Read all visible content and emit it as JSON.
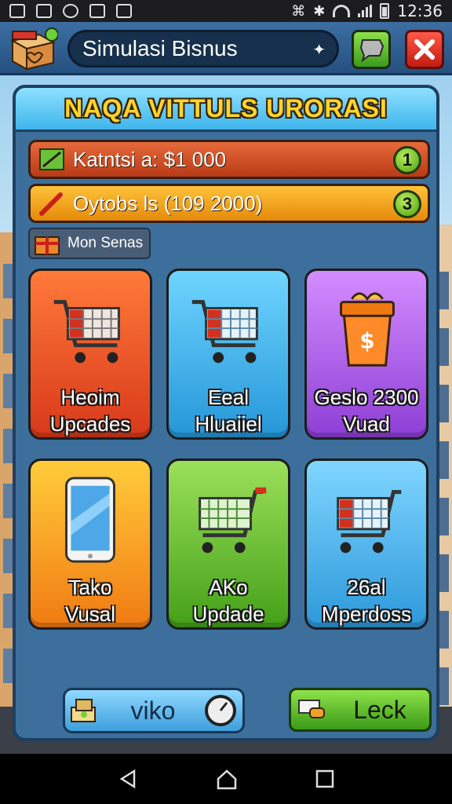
{
  "statusbar": {
    "time": "12:36"
  },
  "header": {
    "title": "Simulasi Bisnus",
    "logo_text": ""
  },
  "panel": {
    "title": "NAQA VITTULS URORASI",
    "bars": [
      {
        "text": "Katntsi a: $1 000",
        "badge": "1"
      },
      {
        "text": "Oytobs ls (109 2000)",
        "badge": "3"
      }
    ],
    "tag": "Mon Senas"
  },
  "tiles": [
    {
      "label": "Heoim\nUpcades",
      "icon": "cart-icon"
    },
    {
      "label": "Eeal\nHluaiiel",
      "icon": "cart-icon"
    },
    {
      "label": "Geslo 2300\nVuad",
      "icon": "gift-bag-icon"
    },
    {
      "label": "Tako\nVusal",
      "icon": "phone-icon"
    },
    {
      "label": "AKo\nUpdade",
      "icon": "cart-icon"
    },
    {
      "label": "26al\nMperdoss",
      "icon": "cart-icon"
    }
  ],
  "buttons": {
    "viko": "viko",
    "leck": "Leck"
  },
  "colors": {
    "accent": "#ffd52a",
    "panel": "#3c6f9b",
    "header": "#25507f"
  }
}
